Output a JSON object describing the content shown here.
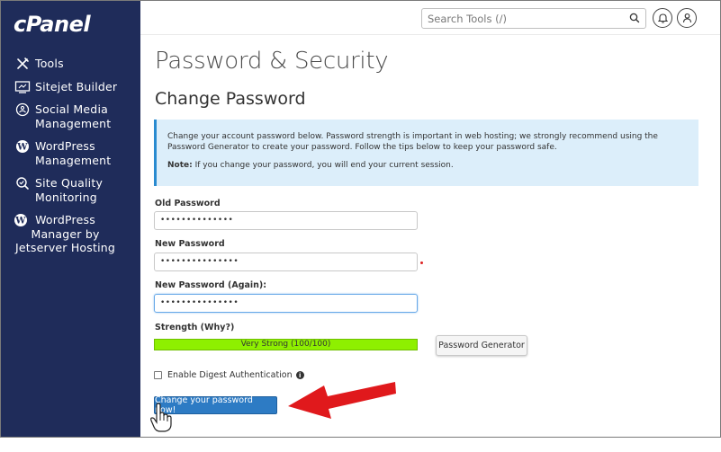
{
  "brand": {
    "logo_text": "cPanel"
  },
  "sidebar": {
    "items": [
      {
        "label": "Tools",
        "icon": "tools-icon"
      },
      {
        "label": "Sitejet Builder",
        "icon": "sitejet-icon"
      },
      {
        "label": "Social Media\nManagement",
        "icon": "social-media-icon"
      },
      {
        "label": "WordPress\nManagement",
        "icon": "wordpress-icon"
      },
      {
        "label": "Site Quality\nMonitoring",
        "icon": "site-quality-icon"
      },
      {
        "label": "WordPress\nManager by\nJetserver Hosting",
        "icon": "wordpress-icon"
      }
    ]
  },
  "topbar": {
    "search_placeholder": "Search Tools (/)",
    "notifications_icon": "bell-icon",
    "user_icon": "user-icon"
  },
  "page": {
    "title": "Password & Security",
    "section_title": "Change Password",
    "alert_text": "Change your account password below. Password strength is important in web hosting; we strongly recommend using the Password Generator to create your password. Follow the tips below to keep your password safe.",
    "note_label": "Note:",
    "note_text": " If you change your password, you will end your current session."
  },
  "form": {
    "old_password_label": "Old Password",
    "old_password_value": "••••••••••••••",
    "new_password_label": "New Password",
    "new_password_value": "•••••••••••••••",
    "new_password_again_label": "New Password (Again):",
    "new_password_again_value": "•••••••••••••••",
    "strength_label": "Strength (Why?)",
    "strength_text": "Very Strong (100/100)",
    "strength_percent": 100,
    "password_generator_label": "Password Generator",
    "digest_auth_label": "Enable Digest Authentication",
    "digest_auth_checked": false,
    "submit_label": "Change your password now!"
  },
  "colors": {
    "sidebar_bg": "#1f2c5a",
    "alert_bg": "#dceefa",
    "strength_fill": "#8ef000",
    "submit_bg": "#2d7bc4",
    "annotation_arrow": "#e0191c"
  }
}
